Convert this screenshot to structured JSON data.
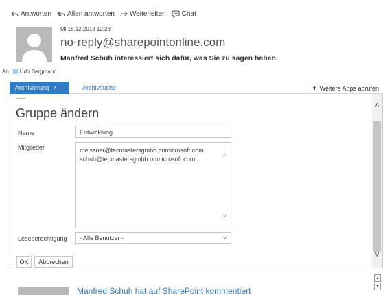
{
  "toolbar": {
    "reply": "Antworten",
    "reply_all": "Allen antworten",
    "forward": "Weiterleiten",
    "chat": "Chat"
  },
  "message": {
    "date": "Mi 18.12.2013 12:28",
    "sender": "no-reply@sharepointonline.com",
    "subject": "Manfred Schuh interessiert sich dafür, was Sie zu sagen haben.",
    "to_label": "An",
    "recipient": "Udo Bergmann"
  },
  "tabs": {
    "active": "Archivierung",
    "second": "Archivsuche",
    "more_apps": "Weitere Apps abrufen"
  },
  "panel": {
    "title": "Gruppe ändern",
    "name_label": "Name",
    "name_value": "Entwicklung",
    "members_label": "Mitglieder",
    "members": [
      "meissner@tecmastersgmbh.onmicrosoft.com",
      "schuh@tecmastersgmbh.onmicrosoft.com"
    ],
    "read_label": "Leseberechtigung",
    "read_value": "- Alle Benutzer -",
    "ok": "OK",
    "cancel": "Abbrechen"
  },
  "footer": {
    "preview_text": "Manfred Schuh hat auf SharePoint kommentiert"
  },
  "colors": {
    "accent": "#2f7bc5",
    "avatar": "#b9b9b9"
  }
}
